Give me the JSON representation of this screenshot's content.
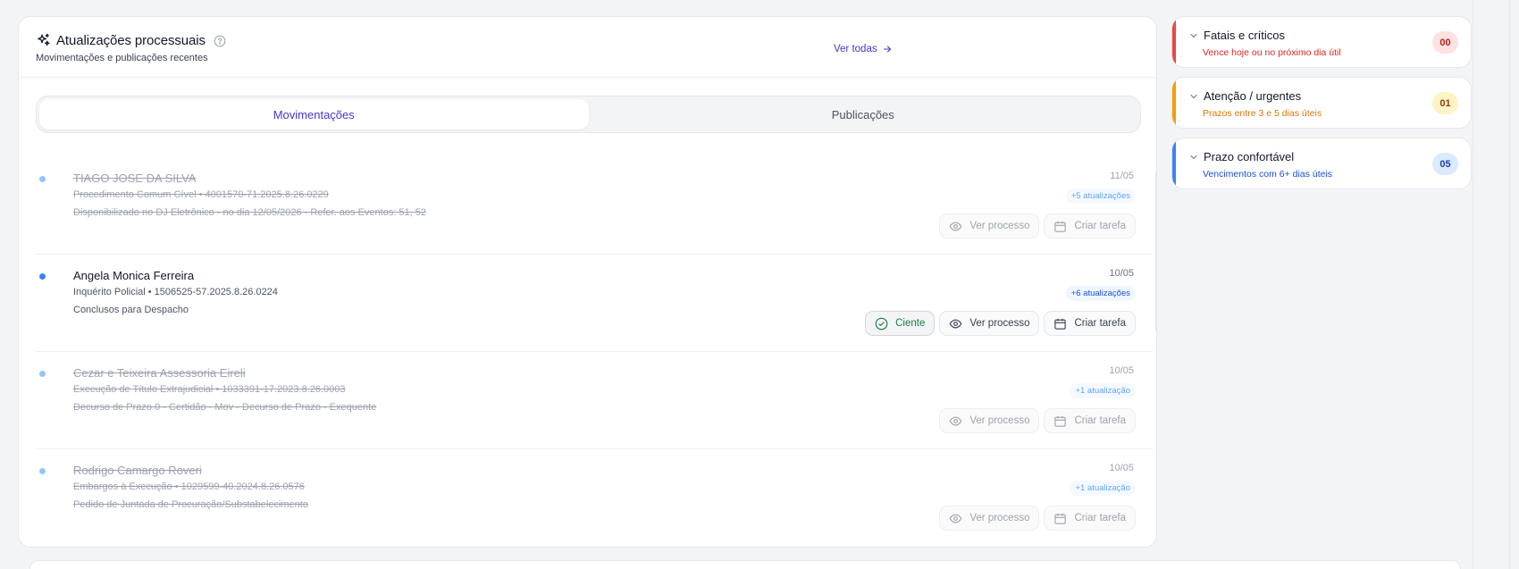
{
  "panel": {
    "title": "Atualizações processuais",
    "subtitle": "Movimentações e publicações recentes",
    "see_all": "Ver todas"
  },
  "tabs": [
    {
      "label": "Movimentações",
      "active": true
    },
    {
      "label": "Publicações",
      "active": false
    }
  ],
  "actions": {
    "view": "Ver processo",
    "task": "Criar tarefa",
    "ack": "Ciente"
  },
  "items": [
    {
      "name": "TIAGO JOSE DA SILVA",
      "process": "Procedimento Comum Cível • 4001570-71.2025.8.26.0229",
      "description": "Disponibilizado no DJ Eletrônico - no dia 12/05/2026 - Refer. aos Eventos: 51, 52",
      "date": "11/05",
      "updates": "+5 atualizações",
      "done": true
    },
    {
      "name": "Angela Monica Ferreira",
      "process": "Inquérito Policial • 1506525-57.2025.8.26.0224",
      "description": "Conclusos para Despacho",
      "date": "10/05",
      "updates": "+6 atualizações",
      "done": false
    },
    {
      "name": "Cezar e Teixeira Assessoria Eireli",
      "process": "Execução de Título Extrajudicial • 1033391-17.2023.8.26.0003",
      "description": "Decurso de Prazo 0 - Certidão - Mov - Decurso de Prazo - Exequente",
      "date": "10/05",
      "updates": "+1 atualização",
      "done": true
    },
    {
      "name": "Rodrigo Camargo Roveri",
      "process": "Embargos à Execução • 1029599-40.2024.8.26.0576",
      "description": "Pedido de Juntada de Procuração/Substabelecimento",
      "date": "10/05",
      "updates": "+1 atualização",
      "done": true
    }
  ],
  "deadlines": [
    {
      "title": "Fatais e críticos",
      "subtitle": "Vence hoje ou no próximo dia útil",
      "count": "00",
      "color": "#ef4444",
      "subcolor": "#dc2626",
      "badge_bg": "#fee2e2",
      "badge_fg": "#b91c1c"
    },
    {
      "title": "Atenção / urgentes",
      "subtitle": "Prazos entre 3 e 5 dias úteis",
      "count": "01",
      "color": "#f59e0b",
      "subcolor": "#d97706",
      "badge_bg": "#fef3c7",
      "badge_fg": "#92400e"
    },
    {
      "title": "Prazo confortável",
      "subtitle": "Vencimentos com 6+ dias úteis",
      "count": "05",
      "color": "#3b82f6",
      "subcolor": "#1d4ed8",
      "badge_bg": "#dbeafe",
      "badge_fg": "#1e40af"
    }
  ]
}
